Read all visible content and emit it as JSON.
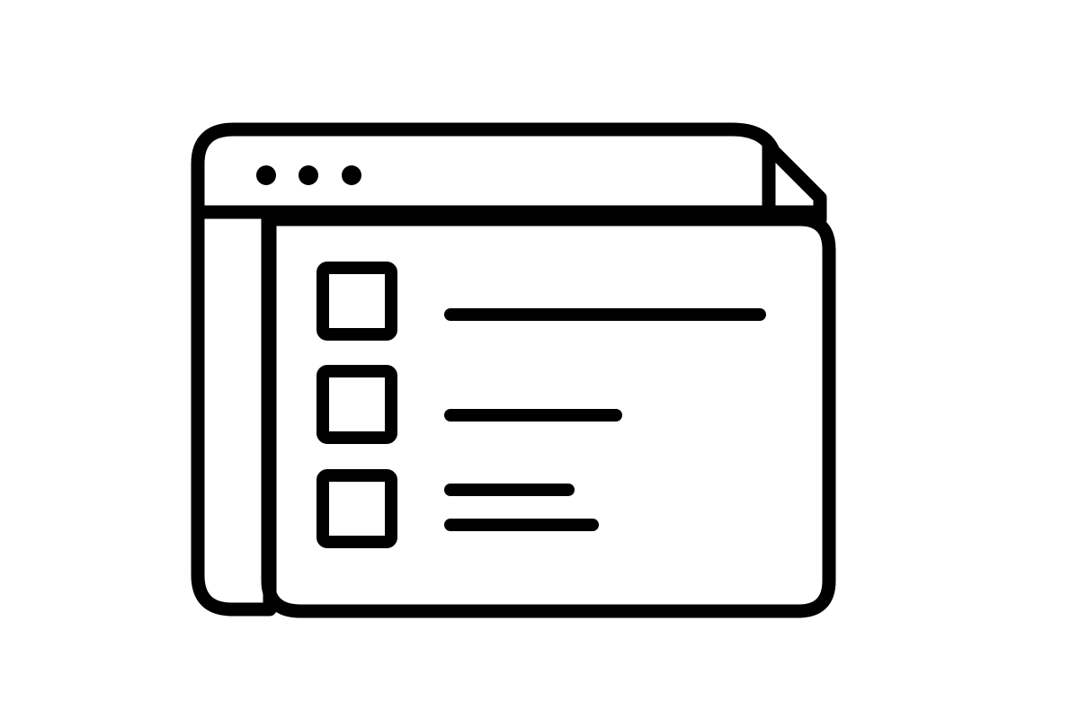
{
  "icon": {
    "name": "browser-window-checklist-icon",
    "stroke_color": "#000000",
    "fill_color": "#ffffff",
    "background_color": "#ffffff",
    "title_bar": {
      "dot_count": 3
    },
    "checklist": {
      "items": [
        {
          "checked": false,
          "text_line_count": 1
        },
        {
          "checked": false,
          "text_line_count": 1
        },
        {
          "checked": false,
          "text_line_count": 2
        }
      ]
    }
  }
}
